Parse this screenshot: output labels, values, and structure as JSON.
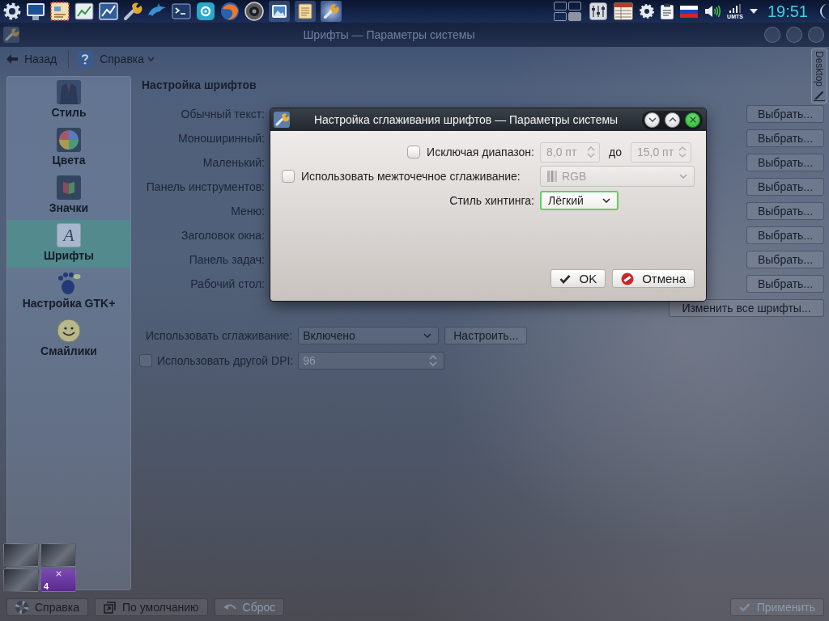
{
  "panel": {
    "tasks": [
      {
        "selected": false
      },
      {
        "selected": false
      },
      {
        "selected": true
      }
    ],
    "pager": [
      {
        "selected": false
      },
      {
        "selected": false
      },
      {
        "selected": false
      },
      {
        "selected": true
      }
    ],
    "network_label": "UMTS",
    "clock": "19:51"
  },
  "settings_window": {
    "title": "Шрифты — Параметры системы",
    "toolbar": {
      "back": "Назад",
      "help": "Справка"
    },
    "sidebar": [
      {
        "label": "Стиль",
        "selected": false
      },
      {
        "label": "Цвета",
        "selected": false
      },
      {
        "label": "Значки",
        "selected": false
      },
      {
        "label": "Шрифты",
        "selected": true,
        "glyph": "A"
      },
      {
        "label": "Настройка GTK+",
        "selected": false
      },
      {
        "label": "Смайлики",
        "selected": false
      }
    ],
    "fonts": {
      "heading": "Настройка шрифтов",
      "rows": [
        {
          "label": "Обычный текст:",
          "button": "Выбрать..."
        },
        {
          "label": "Моноширинный:",
          "button": "Выбрать..."
        },
        {
          "label": "Маленький:",
          "button": "Выбрать..."
        },
        {
          "label": "Панель инструментов:",
          "button": "Выбрать..."
        },
        {
          "label": "Меню:",
          "button": "Выбрать..."
        },
        {
          "label": "Заголовок окна:",
          "button": "Выбрать..."
        },
        {
          "label": "Панель задач:",
          "button": "Выбрать..."
        },
        {
          "label": "Рабочий стол:",
          "button": "Выбрать..."
        }
      ],
      "change_all": "Изменить все шрифты...",
      "antialiasing": {
        "label": "Использовать сглаживание:",
        "value": "Включено",
        "configure": "Настроить..."
      },
      "dpi": {
        "label": "Использовать другой DPI:",
        "checked": false,
        "value": "96"
      }
    },
    "buttons": [
      {
        "kind": "help",
        "label": "Справка",
        "disabled": false
      },
      {
        "kind": "defaults",
        "label": "По умолчанию",
        "disabled": false
      },
      {
        "kind": "reset",
        "label": "Сброс",
        "disabled": true
      },
      {
        "kind": "apply",
        "label": "Применить",
        "disabled": true
      }
    ]
  },
  "dialog": {
    "title": "Настройка сглаживания шрифтов — Параметры системы",
    "exclude_range": {
      "label": "Исключая диапазон:",
      "checked": false,
      "from": "8,0 пт",
      "to_label": "до",
      "to": "15,0 пт"
    },
    "subpixel": {
      "label": "Использовать межточечное сглаживание:",
      "checked": false,
      "value": "RGB"
    },
    "hinting": {
      "label": "Стиль хинтинга:",
      "value": "Лёгкий",
      "focused": true
    },
    "buttons": [
      {
        "kind": "ok",
        "label": "OK"
      },
      {
        "kind": "cancel",
        "label": "Отмена"
      }
    ]
  },
  "desktop_tab": {
    "label": "Desktop"
  },
  "desktop_switcher": {
    "label": "4",
    "desktops": [
      {
        "selected": false
      },
      {
        "selected": false
      },
      {
        "selected": false
      },
      {
        "selected": true
      }
    ]
  }
}
